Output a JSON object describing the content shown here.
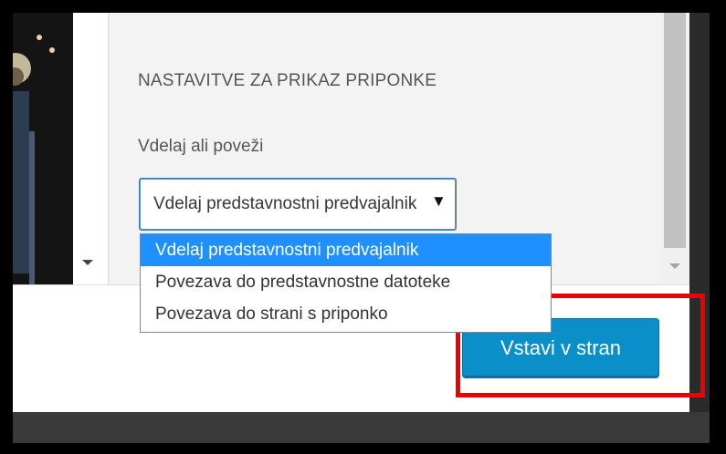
{
  "settings": {
    "section_title": "NASTAVITVE ZA PRIKAZ PRIPONKE",
    "embed_label": "Vdelaj ali poveži",
    "select_value": "Vdelaj predstavnostni predvajalnik",
    "select_arrow": "▼",
    "options": [
      "Vdelaj predstavnostni predvajalnik",
      "Povezava do predstavnostne datoteke",
      "Povezava do strani s priponko"
    ],
    "selected_index": 0
  },
  "toolbar": {
    "insert_label": "Vstavi v stran"
  },
  "colors": {
    "primary_button": "#0a8fc9",
    "highlight": "#ee0000",
    "option_selected": "#1e90ff"
  },
  "icons": {
    "dropdown": "triangle-down-icon",
    "scroll_down": "triangle-down-icon"
  }
}
